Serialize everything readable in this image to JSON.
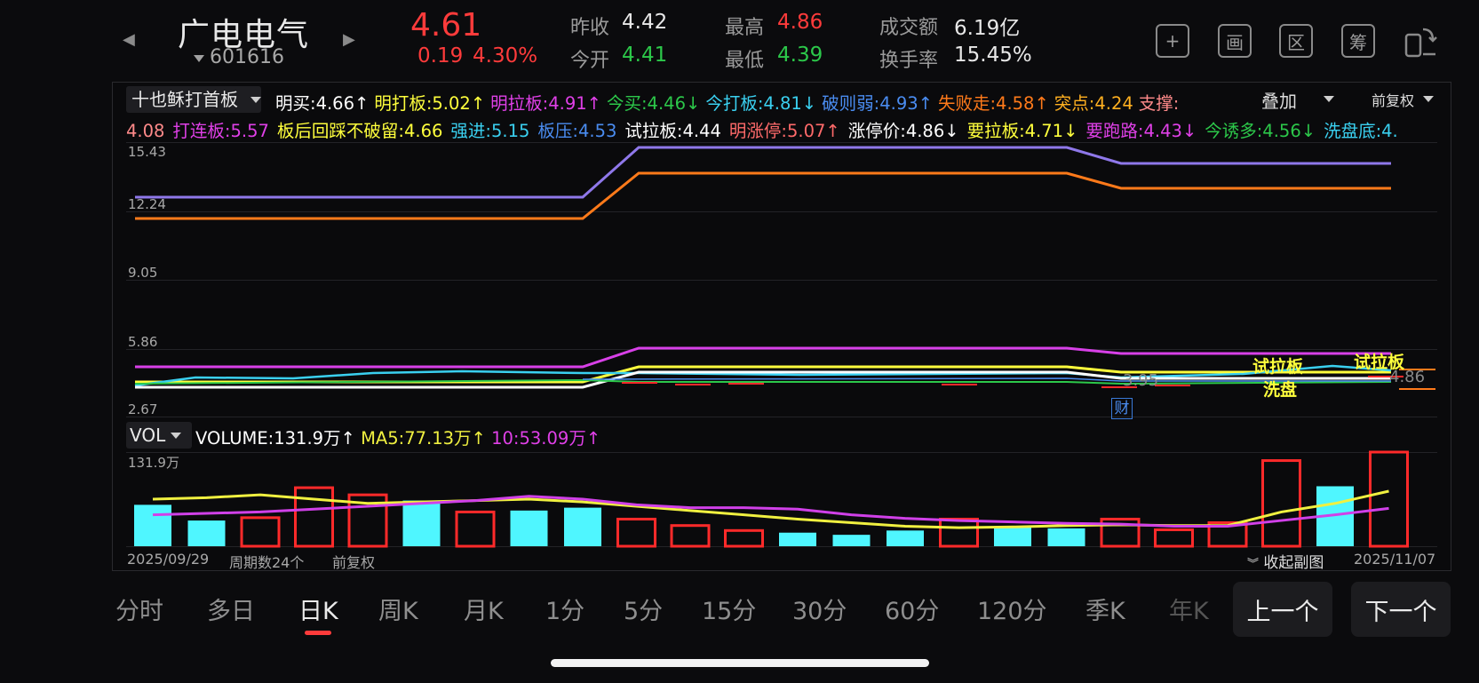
{
  "header": {
    "name": "广电电气",
    "code": "601616",
    "price": "4.61",
    "change": "0.19",
    "change_pct": "4.30%",
    "prev_close_label": "昨收",
    "prev_close": "4.42",
    "open_label": "今开",
    "open": "4.41",
    "high_label": "最高",
    "high": "4.86",
    "low_label": "最低",
    "low": "4.39",
    "amount_label": "成交额",
    "amount": "6.19亿",
    "turnover_label": "换手率",
    "turnover": "15.45%",
    "tools": [
      {
        "label": "+",
        "icon": "plus-icon"
      },
      {
        "label": "画",
        "icon": "draw-icon"
      },
      {
        "label": "区",
        "icon": "range-icon"
      },
      {
        "label": "筹",
        "icon": "chips-icon"
      },
      {
        "label": "",
        "icon": "landscape-rotate-icon"
      }
    ]
  },
  "indicator": {
    "name": "十也稣打首板",
    "overlay": "叠加",
    "adjust": "前复权",
    "row1": [
      {
        "text": "明买:4.66↑",
        "color": "#ffffff"
      },
      {
        "text": "明打板:5.02↑",
        "color": "#ffff3c"
      },
      {
        "text": "明拉板:4.91↑",
        "color": "#e040e8"
      },
      {
        "text": "今买:4.46↓",
        "color": "#2cc84a"
      },
      {
        "text": "今打板:4.81↓",
        "color": "#3ad0f0"
      },
      {
        "text": "破则弱:4.93↑",
        "color": "#4a8cf0"
      },
      {
        "text": "失败走:4.58↑",
        "color": "#ff7a1a"
      },
      {
        "text": "突点:4.24",
        "color": "#ffb020"
      },
      {
        "text": "支撑:",
        "color": "#ff8a8a"
      }
    ],
    "row2": [
      {
        "text": "4.08",
        "color": "#ff8a8a"
      },
      {
        "text": "打连板:5.57",
        "color": "#e040e8"
      },
      {
        "text": "板后回踩不破留:4.66",
        "color": "#ffff3c"
      },
      {
        "text": "强进:5.15",
        "color": "#3ad0f0"
      },
      {
        "text": "板压:4.53",
        "color": "#4a8cf0"
      },
      {
        "text": "试拉板:4.44",
        "color": "#ffffff"
      },
      {
        "text": "明涨停:5.07↑",
        "color": "#ff6a6a"
      },
      {
        "text": "涨停价:4.86↓",
        "color": "#ffffff"
      },
      {
        "text": "要拉板:4.71↓",
        "color": "#ffff3c"
      },
      {
        "text": "要跑路:4.43↓",
        "color": "#e040e8"
      },
      {
        "text": "今诱多:4.56↓",
        "color": "#2cc84a"
      },
      {
        "text": "洗盘底:4.",
        "color": "#3ad0f0"
      }
    ],
    "y_ticks": [
      "15.43",
      "12.24",
      "9.05",
      "5.86",
      "2.67"
    ]
  },
  "main_chart": {
    "annotations": [
      {
        "text": "试拉板",
        "color": "#ffff3c"
      },
      {
        "text": "洗盘",
        "color": "#ffff3c"
      },
      {
        "text": "试拉板",
        "color": "#ffff3c"
      },
      {
        "text": "3.95",
        "color": "#888888"
      },
      {
        "text": "4.86",
        "color": "#888888"
      }
    ],
    "event_marker": "财"
  },
  "volume": {
    "selector": "VOL",
    "volume_text": "VOLUME:131.9万↑",
    "ma5_text": "MA5:77.13万↑",
    "ma10_text": "10:53.09万↑",
    "max_label": "131.9万",
    "start_date": "2025/09/29",
    "period_count": "周期数24个",
    "adjust": "前复权",
    "collapse": "收起副图",
    "end_date": "2025/11/07",
    "colors": {
      "up": "#ff2a2a",
      "down": "#4ff6ff",
      "ma5": "#f0f040",
      "ma10": "#d040e8"
    }
  },
  "chart_data": {
    "type": "bar",
    "title": "",
    "ylabel": "",
    "x_range": [
      "2025/09/29",
      "2025/11/07"
    ],
    "ylim": [
      0,
      131.9
    ],
    "series": [
      {
        "name": "VOLUME",
        "values": [
          58,
          36,
          40,
          82,
          72,
          64,
          48,
          50,
          54,
          38,
          29,
          22,
          19,
          16,
          22,
          38,
          27,
          25,
          38,
          23,
          33,
          120,
          84,
          131.9
        ],
        "direction": [
          "down",
          "down",
          "up",
          "up",
          "up",
          "down",
          "up",
          "down",
          "down",
          "up",
          "up",
          "up",
          "down",
          "down",
          "down",
          "up",
          "down",
          "down",
          "up",
          "up",
          "up",
          "up",
          "down",
          "up"
        ]
      },
      {
        "name": "MA5",
        "values": [
          66,
          68,
          72,
          66,
          60,
          62,
          64,
          66,
          62,
          56,
          50,
          44,
          38,
          33,
          28,
          26,
          27,
          29,
          30,
          29,
          29,
          48,
          60,
          77.13
        ]
      },
      {
        "name": "10",
        "values": [
          44,
          46,
          48,
          52,
          56,
          60,
          64,
          70,
          66,
          58,
          54,
          54,
          52,
          44,
          39,
          36,
          34,
          32,
          31,
          28,
          28,
          36,
          44,
          53.09
        ]
      }
    ]
  },
  "tabs": [
    "分时",
    "多日",
    "日K",
    "周K",
    "月K",
    "1分",
    "5分",
    "15分",
    "30分",
    "60分",
    "120分",
    "季K",
    "年K"
  ],
  "active_tab": "日K",
  "prev_button": "上一个",
  "next_button": "下一个"
}
